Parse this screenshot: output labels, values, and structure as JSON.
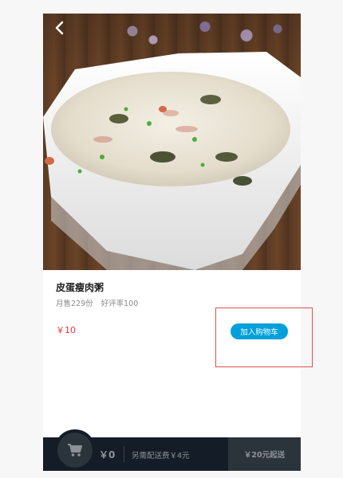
{
  "product": {
    "name": "皮蛋瘦肉粥",
    "monthly_sales": "月售229份",
    "rating": "好评率100",
    "price": "￥10",
    "add_to_cart_label": "加入购物车"
  },
  "cart": {
    "total": "￥0",
    "delivery_fee": "另需配送费￥4元",
    "min_order": "￥20元起送"
  },
  "icons": {
    "back": "chevron-left-icon",
    "cart": "shopping-cart-icon"
  },
  "colors": {
    "accent": "#00a0dc",
    "price": "#e33333",
    "cartbar": "#141d27"
  }
}
